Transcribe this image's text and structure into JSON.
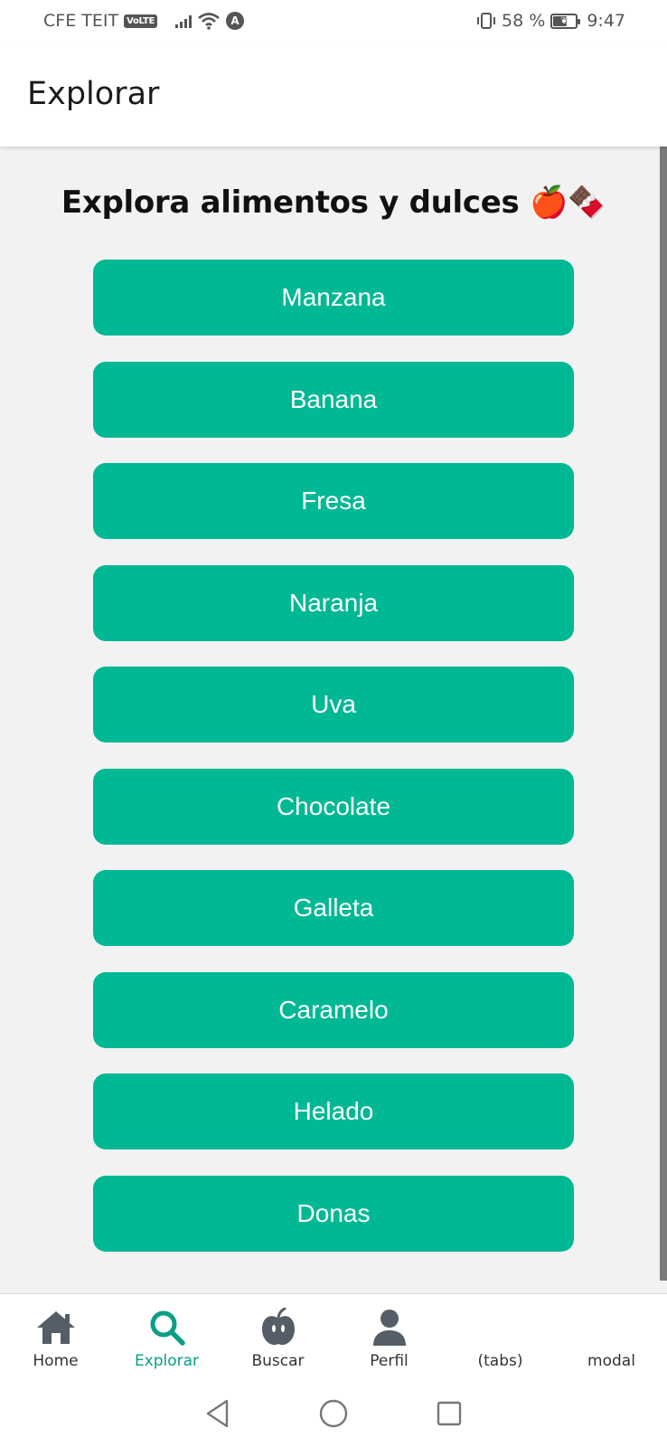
{
  "status": {
    "carrier": "CFE TEIT",
    "volte": "VoLTE",
    "badge": "A",
    "battery": "58 %",
    "battery_level": 0.58,
    "time": "9:47"
  },
  "header": {
    "title": "Explorar"
  },
  "main": {
    "heading": "Explora alimentos y dulces 🍎🍫",
    "items": [
      "Manzana",
      "Banana",
      "Fresa",
      "Naranja",
      "Uva",
      "Chocolate",
      "Galleta",
      "Caramelo",
      "Helado",
      "Donas"
    ]
  },
  "tabs": [
    {
      "label": "Home",
      "icon": "home-icon"
    },
    {
      "label": "Explorar",
      "icon": "search-icon",
      "active": true
    },
    {
      "label": "Buscar",
      "icon": "apple-icon"
    },
    {
      "label": "Perfil",
      "icon": "person-icon"
    },
    {
      "label": "(tabs)",
      "icon": ""
    },
    {
      "label": "modal",
      "icon": ""
    }
  ],
  "colors": {
    "accent": "#00b894",
    "active_tab": "#0a9e85",
    "content_bg": "#f2f2f2",
    "icon_gray": "#555e66"
  }
}
